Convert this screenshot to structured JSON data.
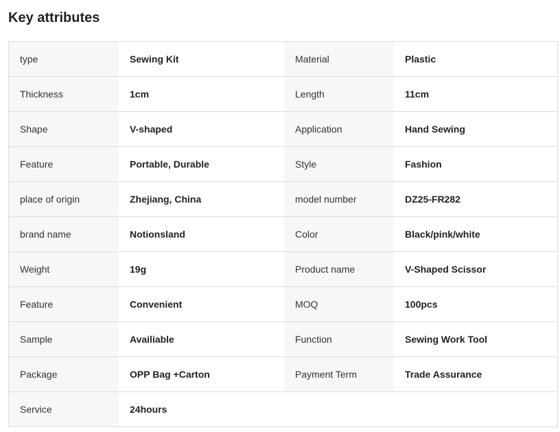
{
  "heading": "Key attributes",
  "rows": [
    {
      "k1": "type",
      "v1": "Sewing Kit",
      "k2": "Material",
      "v2": "Plastic"
    },
    {
      "k1": "Thickness",
      "v1": "1cm",
      "k2": "Length",
      "v2": "11cm"
    },
    {
      "k1": "Shape",
      "v1": "V-shaped",
      "k2": "Application",
      "v2": "Hand Sewing"
    },
    {
      "k1": "Feature",
      "v1": "Portable, Durable",
      "k2": "Style",
      "v2": "Fashion"
    },
    {
      "k1": "place of origin",
      "v1": "Zhejiang, China",
      "k2": "model number",
      "v2": "DZ25-FR282"
    },
    {
      "k1": "brand name",
      "v1": "Notionsland",
      "k2": "Color",
      "v2": "Black/pink/white"
    },
    {
      "k1": "Weight",
      "v1": "19g",
      "k2": "Product name",
      "v2": "V-Shaped Scissor"
    },
    {
      "k1": "Feature",
      "v1": "Convenient",
      "k2": "MOQ",
      "v2": "100pcs"
    },
    {
      "k1": "Sample",
      "v1": "Availiable",
      "k2": "Function",
      "v2": "Sewing Work Tool"
    },
    {
      "k1": "Package",
      "v1": "OPP Bag +Carton",
      "k2": "Payment Term",
      "v2": "Trade Assurance"
    },
    {
      "k1": "Service",
      "v1": "24hours",
      "k2": "",
      "v2": ""
    }
  ]
}
